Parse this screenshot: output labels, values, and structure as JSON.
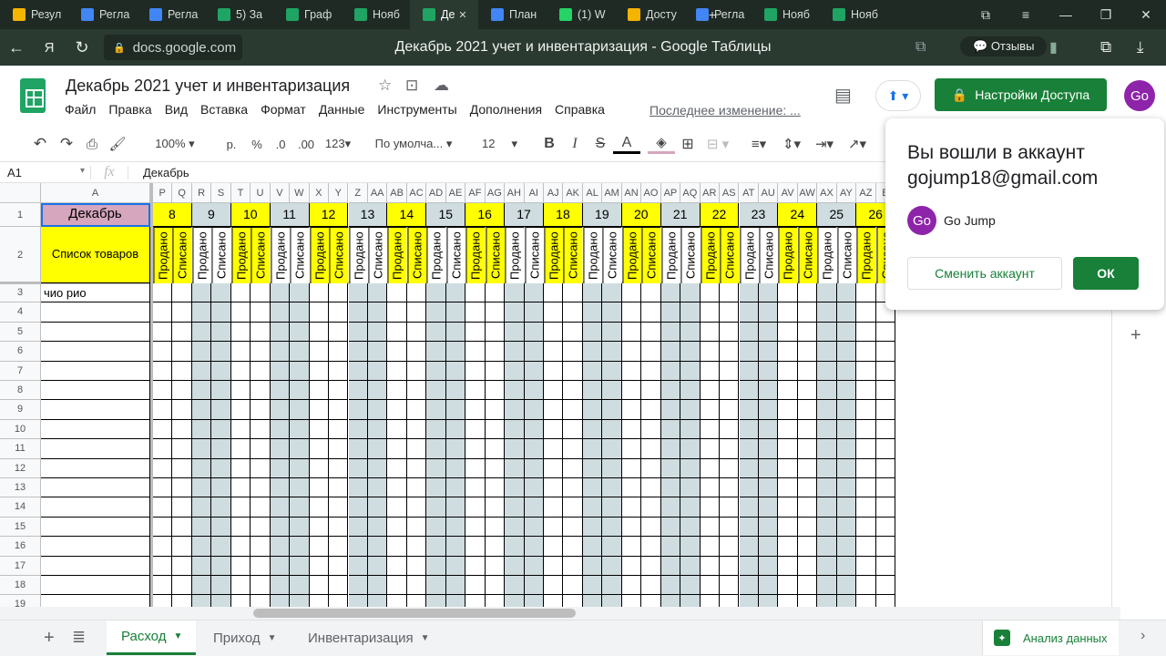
{
  "browser": {
    "tabs": [
      {
        "label": "Резул",
        "icon": "google-drive-icon",
        "color": "#f4b400"
      },
      {
        "label": "Регла",
        "icon": "google-docs-icon",
        "color": "#4285f4"
      },
      {
        "label": "Регла",
        "icon": "google-docs-icon",
        "color": "#4285f4"
      },
      {
        "label": "5) За",
        "icon": "google-sheets-icon",
        "color": "#1fa463"
      },
      {
        "label": "Граф",
        "icon": "google-sheets-icon",
        "color": "#1fa463"
      },
      {
        "label": "Нояб",
        "icon": "google-sheets-icon",
        "color": "#1fa463"
      },
      {
        "label": "Де",
        "icon": "google-sheets-icon",
        "color": "#1fa463",
        "active": true
      },
      {
        "label": "План",
        "icon": "google-docs-icon",
        "color": "#4285f4"
      },
      {
        "label": "(1) W",
        "icon": "whatsapp-icon",
        "color": "#25d366"
      },
      {
        "label": "Досту",
        "icon": "google-drive-icon",
        "color": "#f4b400"
      },
      {
        "label": "Регла",
        "icon": "google-docs-icon",
        "color": "#4285f4"
      },
      {
        "label": "Нояб",
        "icon": "google-sheets-icon",
        "color": "#1fa463"
      },
      {
        "label": "Нояб",
        "icon": "google-sheets-icon",
        "color": "#1fa463"
      }
    ],
    "url": "docs.google.com",
    "page_title": "Декабрь 2021 учет и инвентаризация - Google Таблицы",
    "reviews_label": "Отзывы"
  },
  "doc": {
    "title": "Декабрь 2021 учет и инвентаризация",
    "menus": [
      "Файл",
      "Правка",
      "Вид",
      "Вставка",
      "Формат",
      "Данные",
      "Инструменты",
      "Дополнения",
      "Справка"
    ],
    "last_edit": "Последнее изменение: ...",
    "share_label": "Настройки Доступа",
    "avatar": "Go"
  },
  "toolbar": {
    "zoom": "100%",
    "currency": "р.",
    "percent": "%",
    "dec_less": ".0",
    "dec_more": ".00",
    "format_more": "123",
    "font": "По умолча...",
    "font_size": "12",
    "bold": "B",
    "italic": "I",
    "strike": "S",
    "text_color": "A"
  },
  "formula_bar": {
    "cell_ref": "A1",
    "fx": "fx",
    "content": "Декабрь"
  },
  "grid": {
    "col_a_header": "A",
    "col_letters": [
      "P",
      "Q",
      "R",
      "S",
      "T",
      "U",
      "V",
      "W",
      "X",
      "Y",
      "Z",
      "AA",
      "AB",
      "AC",
      "AD",
      "AE",
      "AF",
      "AG",
      "AH",
      "AI",
      "AJ",
      "AK",
      "AL",
      "AM",
      "AN",
      "AO",
      "AP",
      "AQ",
      "AR",
      "AS",
      "AT",
      "AU",
      "AV",
      "AW",
      "AX",
      "AY",
      "AZ",
      "B"
    ],
    "days": [
      "8",
      "9",
      "10",
      "11",
      "12",
      "13",
      "14",
      "15",
      "16",
      "17",
      "18",
      "19",
      "20",
      "21",
      "22",
      "23",
      "24",
      "25",
      "26"
    ],
    "sold_label": "Продано",
    "written_off_label": "Списано",
    "a1": "Декабрь",
    "a2": "Список товаров",
    "a3": "чио рио",
    "row_numbers": [
      "1",
      "2",
      "3",
      "4",
      "5",
      "6",
      "7",
      "8",
      "9",
      "10",
      "11",
      "12",
      "13",
      "14",
      "15",
      "16",
      "17",
      "18",
      "19"
    ],
    "colors": {
      "yellow": "#ffff00",
      "gray": "#cfdce0",
      "pink": "#d5a6bd"
    }
  },
  "popup": {
    "title": "Вы вошли в аккаунт",
    "email": "gojump18@gmail.com",
    "avatar": "Go",
    "name": "Go Jump",
    "switch_label": "Сменить аккаунт",
    "ok_label": "ОК"
  },
  "sheets": {
    "tabs": [
      {
        "label": "Расход",
        "active": true
      },
      {
        "label": "Приход",
        "active": false
      },
      {
        "label": "Инвентаризация",
        "active": false
      }
    ],
    "explore_label": "Анализ данных"
  }
}
